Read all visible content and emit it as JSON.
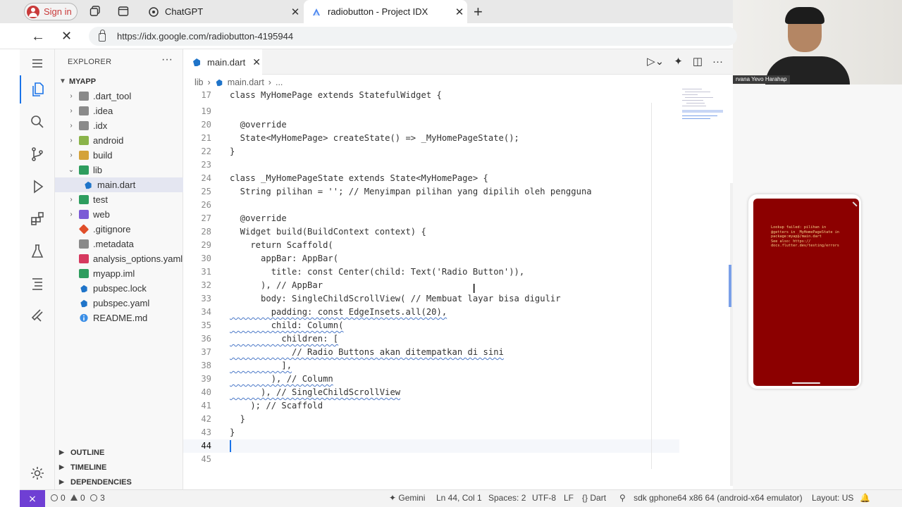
{
  "browser": {
    "signin_label": "Sign in",
    "tabs": [
      {
        "title": "ChatGPT",
        "active": false
      },
      {
        "title": "radiobutton - Project IDX",
        "active": true
      }
    ],
    "url": "https://idx.google.com/radiobutton-4195944"
  },
  "webcam": {
    "name_label": "rvana Yevo Harahap"
  },
  "explorer": {
    "header": "EXPLORER",
    "root": "MYAPP",
    "items": [
      {
        "label": ".dart_tool",
        "kind": "folder",
        "color": "#8a8a8a"
      },
      {
        "label": ".idea",
        "kind": "folder",
        "color": "#8a8a8a"
      },
      {
        "label": ".idx",
        "kind": "folder",
        "color": "#8a8a8a"
      },
      {
        "label": "android",
        "kind": "folder",
        "color": "#8ab34a"
      },
      {
        "label": "build",
        "kind": "folder",
        "color": "#d4a23a"
      },
      {
        "label": "lib",
        "kind": "folder-open",
        "color": "#2e9d5e"
      },
      {
        "label": "main.dart",
        "kind": "file",
        "color": "#1f74c9"
      },
      {
        "label": "test",
        "kind": "folder",
        "color": "#2e9d5e"
      },
      {
        "label": "web",
        "kind": "folder",
        "color": "#7b5bd6"
      },
      {
        "label": ".gitignore",
        "kind": "file",
        "color": "#e04e2a"
      },
      {
        "label": ".metadata",
        "kind": "file",
        "color": "#8a8a8a"
      },
      {
        "label": "analysis_options.yaml",
        "kind": "file",
        "color": "#d6395f"
      },
      {
        "label": "myapp.iml",
        "kind": "file",
        "color": "#2e9d5e"
      },
      {
        "label": "pubspec.lock",
        "kind": "file",
        "color": "#1f74c9"
      },
      {
        "label": "pubspec.yaml",
        "kind": "file",
        "color": "#1f74c9"
      },
      {
        "label": "README.md",
        "kind": "file",
        "color": "#3a8ee6"
      }
    ],
    "sections": [
      "OUTLINE",
      "TIMELINE",
      "DEPENDENCIES"
    ]
  },
  "editor": {
    "tab_label": "main.dart",
    "breadcrumb": [
      "lib",
      "main.dart",
      "..."
    ],
    "lines": [
      {
        "n": "17",
        "code": "class MyHomePage extends StatefulWidget {"
      },
      {
        "n": "19",
        "code": ""
      },
      {
        "n": "20",
        "code": "  @override"
      },
      {
        "n": "21",
        "code": "  State<MyHomePage> createState() => _MyHomePageState();"
      },
      {
        "n": "22",
        "code": "}"
      },
      {
        "n": "23",
        "code": ""
      },
      {
        "n": "24",
        "code": "class _MyHomePageState extends State<MyHomePage> {"
      },
      {
        "n": "25",
        "code": "  String pilihan = ''; // Menyimpan pilihan yang dipilih oleh pengguna"
      },
      {
        "n": "26",
        "code": ""
      },
      {
        "n": "27",
        "code": "  @override"
      },
      {
        "n": "28",
        "code": "  Widget build(BuildContext context) {"
      },
      {
        "n": "29",
        "code": "    return Scaffold("
      },
      {
        "n": "30",
        "code": "      appBar: AppBar("
      },
      {
        "n": "31",
        "code": "        title: const Center(child: Text('Radio Button')),"
      },
      {
        "n": "32",
        "code": "      ), // AppBar"
      },
      {
        "n": "33",
        "code": "      body: SingleChildScrollView( // Membuat layar bisa digulir"
      },
      {
        "n": "34",
        "code": "        padding: const EdgeInsets.all(20),"
      },
      {
        "n": "35",
        "code": "        child: Column("
      },
      {
        "n": "36",
        "code": "          children: ["
      },
      {
        "n": "37",
        "code": "            // Radio Buttons akan ditempatkan di sini"
      },
      {
        "n": "38",
        "code": "          ],"
      },
      {
        "n": "39",
        "code": "        ), // Column"
      },
      {
        "n": "40",
        "code": "      ), // SingleChildScrollView"
      },
      {
        "n": "41",
        "code": "    ); // Scaffold"
      },
      {
        "n": "42",
        "code": "  }"
      },
      {
        "n": "43",
        "code": "}"
      },
      {
        "n": "44",
        "code": ""
      },
      {
        "n": "45",
        "code": ""
      }
    ]
  },
  "preview": {
    "error_text": "Lookup failed: pilihan in\n@getters in _MyHomePageState in\npackage:myapp/main.dart\nSee also: https://\ndocs.flutter.dev/testing/errors",
    "screen_color": "#8c0000"
  },
  "statusbar": {
    "errors": "0",
    "warnings": "0",
    "info": "3",
    "gemini": "Gemini",
    "position": "Ln 44, Col 1",
    "spaces": "Spaces: 2",
    "encoding": "UTF-8",
    "eol": "LF",
    "language": "Dart",
    "device": "sdk gphone64 x86 64 (android-x64 emulator)",
    "layout": "Layout: US"
  }
}
